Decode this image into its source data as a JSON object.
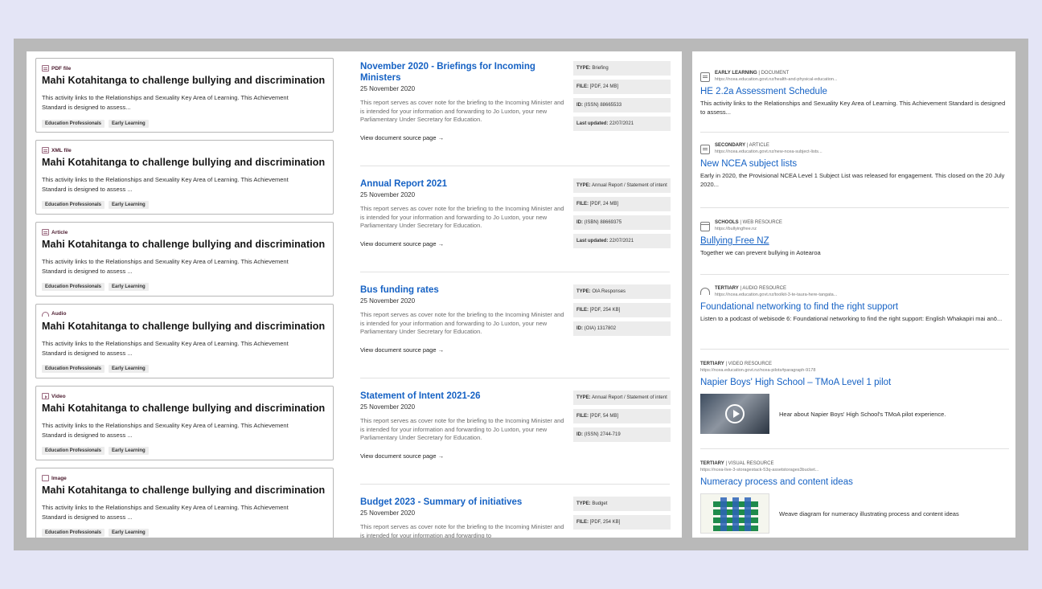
{
  "left": {
    "cards": [
      {
        "type": "PDF file",
        "icon": "document-icon",
        "title": "Mahi Kotahitanga to challenge bullying and discrimination",
        "desc": "This activity links to the Relationships and Sexuality Key Area of Learning. This Achievement Standard is designed to assess...",
        "tags": [
          "Education Professionals",
          "Early Learning"
        ]
      },
      {
        "type": "XML file",
        "icon": "document-icon",
        "title": "Mahi Kotahitanga to challenge bullying and discrimination",
        "desc": "This activity links to the Relationships and Sexuality Key Area of Learning. This Achievement Standard is designed to assess ...",
        "tags": [
          "Education Professionals",
          "Early Learning"
        ]
      },
      {
        "type": "Article",
        "icon": "document-icon",
        "title": "Mahi Kotahitanga to challenge bullying and discrimination",
        "desc": "This activity links to the Relationships and Sexuality Key Area of Learning. This Achievement Standard is designed to assess ...",
        "tags": [
          "Education Professionals",
          "Early Learning"
        ]
      },
      {
        "type": "Audio",
        "icon": "headphones-icon",
        "title": "Mahi Kotahitanga to challenge bullying and discrimination",
        "desc": "This activity links to the Relationships and Sexuality Key Area of Learning. This Achievement Standard is designed to assess ...",
        "tags": [
          "Education Professionals",
          "Early Learning"
        ]
      },
      {
        "type": "Video",
        "icon": "play-icon",
        "title": "Mahi Kotahitanga to challenge bullying and discrimination",
        "desc": "This activity links to the Relationships and Sexuality Key Area of Learning. This Achievement Standard is designed to assess ...",
        "tags": [
          "Education Professionals",
          "Early Learning"
        ]
      },
      {
        "type": "Image",
        "icon": "image-icon",
        "title": "Mahi Kotahitanga to challenge bullying and discrimination",
        "desc": "This activity links to the Relationships and Sexuality Key Area of Learning. This Achievement Standard is designed to assess ...",
        "tags": [
          "Education Professionals",
          "Early Learning"
        ]
      }
    ]
  },
  "middle": {
    "view_link": "View document source page →",
    "items": [
      {
        "title": "November 2020 - Briefings for Incoming Ministers",
        "date": "25 November 2020",
        "desc": "This report serves as cover note for the briefing to the Incoming Minister and is intended for your information and forwarding to Jo Luxton, your new Parliamentary Under Secretary for Education.",
        "meta": [
          {
            "k": "TYPE:",
            "v": " Briefing"
          },
          {
            "k": "FILE:",
            "v": " [PDF, 24 MB]"
          },
          {
            "k": "ID:",
            "v": " (ISSN) 88665533"
          },
          {
            "k": "Last updated:",
            "v": " 22/07/2021"
          }
        ]
      },
      {
        "title": "Annual Report 2021",
        "date": "25 November 2020",
        "desc": "This report serves as cover note for the briefing to the Incoming Minister and is intended for your information and forwarding to Jo Luxton, your new Parliamentary Under Secretary for Education.",
        "meta": [
          {
            "k": "TYPE:",
            "v": " Annual Report / Statement of intent"
          },
          {
            "k": "FILE:",
            "v": " [PDF, 24 MB]"
          },
          {
            "k": "ID:",
            "v": " (ISBN) 88669375"
          },
          {
            "k": "Last updated:",
            "v": " 22/07/2021"
          }
        ]
      },
      {
        "title": "Bus funding rates",
        "date": "25 November 2020",
        "desc": "This report serves as cover note for the briefing to the Incoming Minister and is intended for your information and forwarding to Jo Luxton, your new Parliamentary Under Secretary for Education.",
        "meta": [
          {
            "k": "TYPE:",
            "v": " OIA Responses"
          },
          {
            "k": "FILE:",
            "v": " [PDF, 254 KB]"
          },
          {
            "k": "ID:",
            "v": " (OIA) 1317802"
          }
        ]
      },
      {
        "title": "Statement of Intent 2021-26",
        "date": "25 November 2020",
        "desc": "This report serves as cover note for the briefing to the Incoming Minister and is intended for your information and forwarding to Jo Luxton, your new Parliamentary Under Secretary for Education.",
        "meta": [
          {
            "k": "TYPE:",
            "v": " Annual Report / Statement of intent"
          },
          {
            "k": "FILE:",
            "v": " [PDF, 54 MB]"
          },
          {
            "k": "ID:",
            "v": " (ISSN) 2744-719"
          }
        ]
      },
      {
        "title": "Budget 2023 - Summary of initiatives",
        "date": "25 November 2020",
        "desc": "This report serves as cover note for the briefing to the Incoming Minister and is intended for your information and forwarding to",
        "meta": [
          {
            "k": "TYPE:",
            "v": " Budget"
          },
          {
            "k": "FILE:",
            "v": " [PDF, 254 KB]"
          }
        ]
      }
    ]
  },
  "right": {
    "items": [
      {
        "icon": "document-icon",
        "cat": "EARLY LEARNING",
        "kind": " | DOCUMENT",
        "url": "https://ncea.education.govt.nz/health-and-physical-education...",
        "title": "HE 2.2a Assessment Schedule",
        "desc": "This activity links to the Relationships and Sexuality Key Area of Learning. This Achievement Standard is designed to assess..."
      },
      {
        "icon": "document-icon",
        "cat": "SECONDARY",
        "kind": " | ARTICLE",
        "url": "https://ncea.education.govt.nz/new-ncea-subject-lists...",
        "title": "New NCEA subject lists",
        "desc": "Early in 2020, the Provisional NCEA Level 1 Subject List was released for engagement. This closed on the 20 July 2020..."
      },
      {
        "icon": "web-icon",
        "cat": "SCHOOLS",
        "kind": " | WEB RESOURCE",
        "url": "https://bullyingfree.nz",
        "title": "Bullying Free NZ",
        "desc": "Together we can prevent bullying in Aotearoa"
      },
      {
        "icon": "headphones-icon",
        "cat": "TERTIARY",
        "kind": " | AUDIO RESOURCE",
        "url": "https://ncea.education.govt.nz/toolkit-3-te-taura-here-tangata...",
        "title": "Foundational networking to find the right support",
        "desc": "Listen to a podcast of webisode 6: Foundational networking to find the right support: English Whakapiri mai anō..."
      },
      {
        "cat": "TERTIARY",
        "kind": " | VIDEO RESOURCE",
        "url": "https://ncea.education.govt.nz/ncea-pilots#paragraph-9178",
        "title": "Napier Boys' High School – TMoA Level 1 pilot",
        "caption": "Hear about Napier Boys' High School's TMoA pilot experience."
      },
      {
        "cat": "TERTIARY",
        "kind": " | VISUAL RESOURCE",
        "url": "https://ncea-live-3-storagestack-53q-assetstorages3bucket...",
        "title": "Numeracy process and content ideas",
        "caption": "Weave diagram for numeracy illustrating process and content ideas"
      }
    ]
  }
}
